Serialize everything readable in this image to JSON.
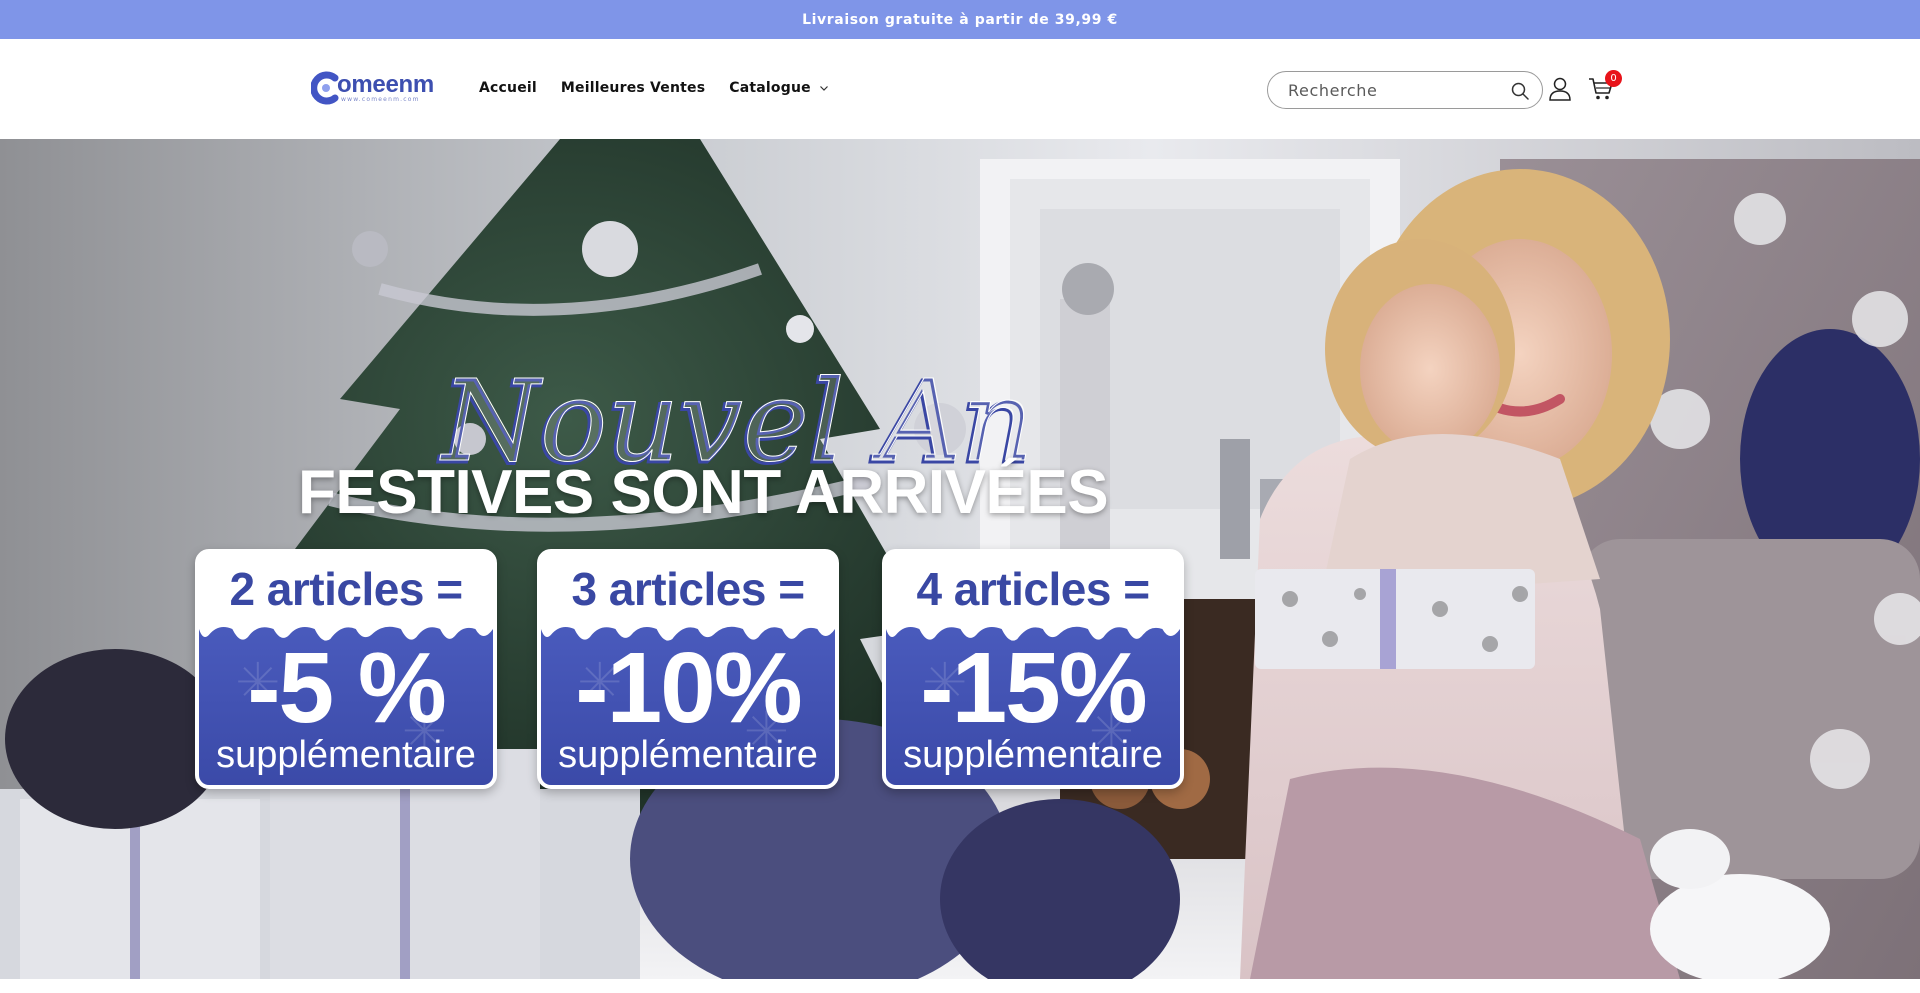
{
  "announcement": {
    "text": "Livraison gratuite à partir de 39,99 €"
  },
  "header": {
    "logo": {
      "name": "omeenm",
      "subtext": "www.comeenm.com"
    },
    "nav": [
      {
        "label": "Accueil"
      },
      {
        "label": "Meilleures Ventes"
      },
      {
        "label": "Catalogue",
        "has_dropdown": true
      }
    ],
    "search": {
      "placeholder": "Recherche",
      "value": ""
    },
    "cart": {
      "count": "0"
    }
  },
  "hero": {
    "script_title": "Nouvel An",
    "headline": "FESTIVES SONT ARRIVÉES",
    "offers": [
      {
        "condition": "2 articles =",
        "discount": "-5 %",
        "label": "supplémentaire"
      },
      {
        "condition": "3 articles =",
        "discount": "-10%",
        "label": "supplémentaire"
      },
      {
        "condition": "4 articles =",
        "discount": "-15%",
        "label": "supplémentaire"
      }
    ]
  },
  "colors": {
    "announcement_bg": "#7f95e8",
    "brand_blue": "#3d4fb0",
    "offer_blue": "#3b4aa8",
    "badge_red": "#e8131a"
  },
  "icons": [
    "search-icon",
    "account-icon",
    "cart-icon",
    "chevron-down-icon"
  ]
}
